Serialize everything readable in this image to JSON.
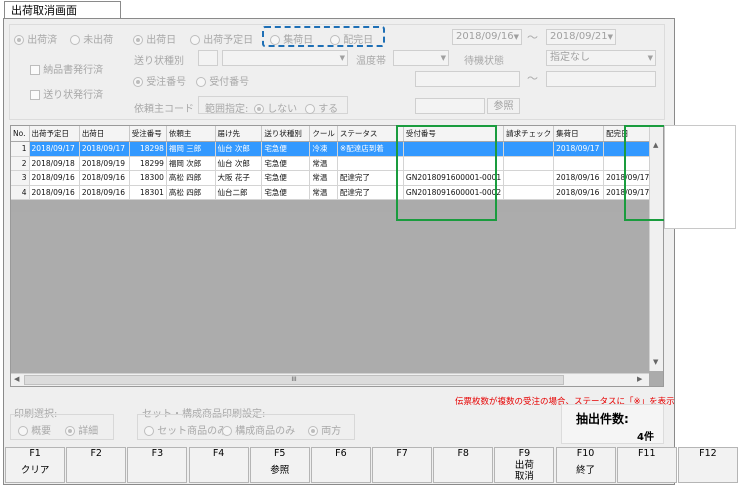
{
  "window": {
    "title": "出荷取消画面"
  },
  "colors": {
    "highlight_blue": "#1e6fb5",
    "highlight_green": "#1a9c3e",
    "notice_red": "#e60000",
    "selection": "#3399ff"
  },
  "filters": {
    "ship_status": {
      "options": [
        "出荷済",
        "未出荷"
      ],
      "selected": "出荷済"
    },
    "date_type": {
      "options": [
        "出荷日",
        "出荷予定日",
        "集荷日",
        "配完日"
      ],
      "selected": "出荷日"
    },
    "date_from": "2018/09/16",
    "date_to": "2018/09/21",
    "range_sep": "〜",
    "checkbox_invoice": "納品書発行済",
    "checkbox_slip": "送り状発行済",
    "slip_type_label": "送り状種別",
    "temp_label": "温度帯",
    "wait_label": "待機状態",
    "wait_value": "指定なし",
    "number_type": {
      "options": [
        "受注番号",
        "受付番号"
      ],
      "selected": "受注番号"
    },
    "requester_code_label": "依頼主コード",
    "range_label": "範囲指定:",
    "range_options": [
      "しない",
      "する"
    ],
    "range_selected": "しない",
    "ref_button": "参照"
  },
  "table": {
    "columns": [
      "No.",
      "出荷予定日",
      "出荷日",
      "受注番号",
      "依頼主",
      "届け先",
      "送り状種別",
      "クール",
      "ステータス",
      "受付番号",
      "請求チェック",
      "集荷日",
      "配完日"
    ],
    "rows": [
      [
        "1",
        "2018/09/17",
        "2018/09/17",
        "18298",
        "福岡 三郎",
        "仙台 次郎",
        "宅急便",
        "冷凍",
        "※配達店到着",
        "",
        "",
        "2018/09/17",
        ""
      ],
      [
        "2",
        "2018/09/18",
        "2018/09/19",
        "18299",
        "福岡 次郎",
        "仙台 次郎",
        "宅急便",
        "常温",
        "",
        "",
        "",
        "",
        ""
      ],
      [
        "3",
        "2018/09/16",
        "2018/09/16",
        "18300",
        "高松 四郎",
        "大阪 花子",
        "宅急便",
        "常温",
        "配達完了",
        "GN2018091600001-0001",
        "",
        "2018/09/16",
        "2018/09/17"
      ],
      [
        "4",
        "2018/09/16",
        "2018/09/16",
        "18301",
        "高松 四郎",
        "仙台二郎",
        "宅急便",
        "常温",
        "配達完了",
        "GN2018091600001-0002",
        "",
        "2018/09/16",
        "2018/09/17"
      ]
    ],
    "selected_row": 1,
    "scroll_center": "III"
  },
  "notice": "伝票枚数が複数の受注の場合、ステータスに「※」を表示",
  "print_select": {
    "label": "印刷選択:",
    "options": [
      "概要",
      "詳細"
    ],
    "selected": "詳細"
  },
  "set_print": {
    "label": "セット・構成商品印刷設定:",
    "options": [
      "セット商品のみ",
      "構成商品のみ",
      "両方"
    ],
    "selected": "両方"
  },
  "count": {
    "label": "抽出件数:",
    "value": "4件"
  },
  "fkeys": [
    {
      "key": "F1",
      "label": "クリア"
    },
    {
      "key": "F2",
      "label": ""
    },
    {
      "key": "F3",
      "label": ""
    },
    {
      "key": "F4",
      "label": ""
    },
    {
      "key": "F5",
      "label": "参照"
    },
    {
      "key": "F6",
      "label": ""
    },
    {
      "key": "F7",
      "label": ""
    },
    {
      "key": "F8",
      "label": ""
    },
    {
      "key": "F9",
      "label": "出荷\n取消"
    },
    {
      "key": "F10",
      "label": "終了"
    },
    {
      "key": "F11",
      "label": ""
    },
    {
      "key": "F12",
      "label": ""
    }
  ]
}
